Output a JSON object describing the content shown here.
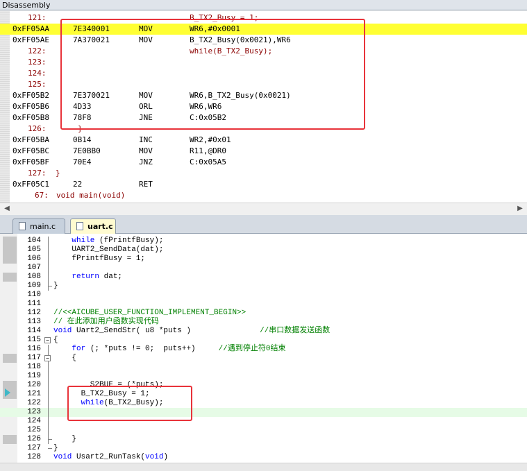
{
  "disassembly": {
    "title": "Disassembly",
    "rows": [
      {
        "type": "src",
        "num": "121:",
        "text": "B_TX2_Busy = 1;",
        "hl": false
      },
      {
        "type": "asm",
        "addr": "0xFF05AA",
        "opcode": "7E340001",
        "mnemonic": "MOV",
        "args": "WR6,#0x0001",
        "hl": true
      },
      {
        "type": "asm",
        "addr": "0xFF05AE",
        "opcode": "7A370021",
        "mnemonic": "MOV",
        "args": "B_TX2_Busy(0x0021),WR6",
        "hl": false
      },
      {
        "type": "src",
        "num": "122:",
        "text": "while(B_TX2_Busy);",
        "hl": false
      },
      {
        "type": "src",
        "num": "123:",
        "text": "",
        "hl": false
      },
      {
        "type": "src",
        "num": "124:",
        "text": "",
        "hl": false
      },
      {
        "type": "src",
        "num": "125:",
        "text": "",
        "hl": false
      },
      {
        "type": "asm",
        "addr": "0xFF05B2",
        "opcode": "7E370021",
        "mnemonic": "MOV",
        "args": "WR6,B_TX2_Busy(0x0021)",
        "hl": false
      },
      {
        "type": "asm",
        "addr": "0xFF05B6",
        "opcode": "4D33",
        "mnemonic": "ORL",
        "args": "WR6,WR6",
        "hl": false
      },
      {
        "type": "asm",
        "addr": "0xFF05B8",
        "opcode": "78F8",
        "mnemonic": "JNE",
        "args": "C:0x05B2",
        "hl": false
      },
      {
        "type": "src",
        "num": "126:",
        "text": "}",
        "hl": false
      },
      {
        "type": "asm",
        "addr": "0xFF05BA",
        "opcode": "0B14",
        "mnemonic": "INC",
        "args": "WR2,#0x01",
        "hl": false
      },
      {
        "type": "asm",
        "addr": "0xFF05BC",
        "opcode": "7E0BB0",
        "mnemonic": "MOV",
        "args": "R11,@DR0",
        "hl": false
      },
      {
        "type": "asm",
        "addr": "0xFF05BF",
        "opcode": "70E4",
        "mnemonic": "JNZ",
        "args": "C:0x05A5",
        "hl": false
      },
      {
        "type": "src2",
        "num": "127:",
        "text": "}",
        "hl": false
      },
      {
        "type": "asm",
        "addr": "0xFF05C1",
        "opcode": "22",
        "mnemonic": "RET",
        "args": "",
        "hl": false
      },
      {
        "type": "src3",
        "num": "67:",
        "text": "void main(void)",
        "hl": false
      }
    ]
  },
  "tabs": [
    {
      "label": "main.c",
      "active": false
    },
    {
      "label": "uart.c",
      "active": true
    }
  ],
  "editor": {
    "lines": [
      {
        "n": "104",
        "html": "    <span class=\"kw\">while</span> (fPrintfBusy);"
      },
      {
        "n": "105",
        "html": "    UART2_SendData(dat);"
      },
      {
        "n": "106",
        "html": "    fPrintfBusy = 1;"
      },
      {
        "n": "107",
        "html": ""
      },
      {
        "n": "108",
        "html": "    <span class=\"kw\">return</span> dat;"
      },
      {
        "n": "109",
        "html": "}"
      },
      {
        "n": "110",
        "html": ""
      },
      {
        "n": "111",
        "html": ""
      },
      {
        "n": "112",
        "html": "<span class=\"cm\">//&lt;&lt;AICUBE_USER_FUNCTION_IMPLEMENT_BEGIN&gt;&gt;</span>"
      },
      {
        "n": "113",
        "html": "<span class=\"cm\">// 在此添加用户函数实现代码</span>"
      },
      {
        "n": "114",
        "html": "<span class=\"kw\">void</span> Uart2_SendStr( u8 *puts )               <span class=\"cm\">//串口数据发送函数</span>"
      },
      {
        "n": "115",
        "html": "{"
      },
      {
        "n": "116",
        "html": "    <span class=\"kw\">for</span> (; *puts != 0;  puts++)     <span class=\"cm\">//遇到停止符0结束</span>"
      },
      {
        "n": "117",
        "html": "    {"
      },
      {
        "n": "118",
        "html": ""
      },
      {
        "n": "119",
        "html": ""
      },
      {
        "n": "120",
        "html": "        S2BUF = (*puts);"
      },
      {
        "n": "121",
        "html": "      B_TX2_Busy = 1;"
      },
      {
        "n": "122",
        "html": "      <span class=\"kw\">while</span>(B_TX2_Busy);"
      },
      {
        "n": "123",
        "html": ""
      },
      {
        "n": "124",
        "html": ""
      },
      {
        "n": "125",
        "html": ""
      },
      {
        "n": "126",
        "html": "    }"
      },
      {
        "n": "127",
        "html": "}"
      },
      {
        "n": "128",
        "html": "<span class=\"kw\">void</span> Usart2_RunTask(<span class=\"kw\">void</span>)"
      }
    ]
  }
}
